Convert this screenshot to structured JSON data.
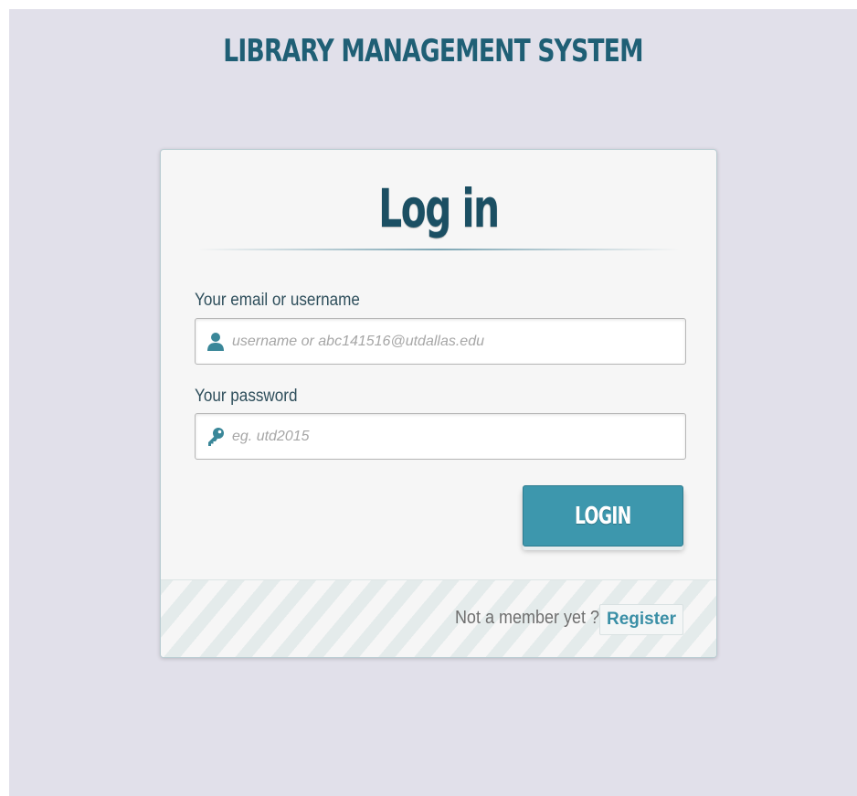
{
  "app": {
    "title": "LIBRARY MANAGEMENT SYSTEM"
  },
  "login_form": {
    "title": "Log in",
    "email": {
      "label": "Your email or username",
      "placeholder": "username or abc141516@utdallas.edu",
      "value": "",
      "icon": "user-icon"
    },
    "password": {
      "label": "Your password",
      "placeholder": "eg. utd2015",
      "value": "",
      "icon": "key-icon"
    },
    "submit_label": "LOGIN"
  },
  "footer": {
    "prompt": "Not a member yet ?",
    "register_label": "Register"
  },
  "colors": {
    "page_background": "#e1e0ea",
    "title": "#1f5f75",
    "accent": "#3d97ad",
    "register_link": "#3a8fa6"
  }
}
